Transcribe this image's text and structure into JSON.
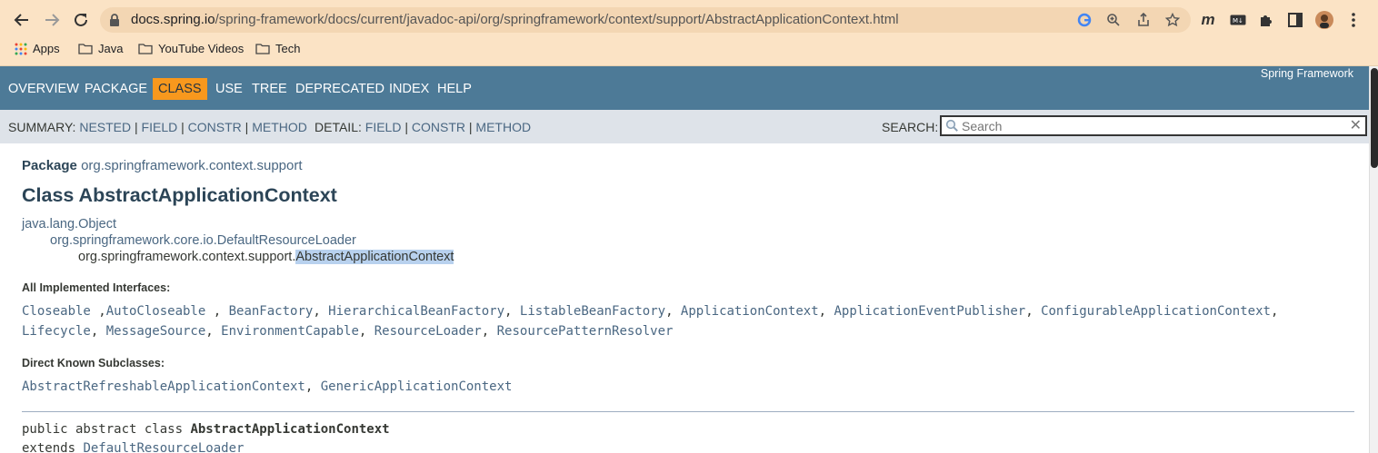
{
  "browser": {
    "url_host": "docs.spring.io",
    "url_path": "/spring-framework/docs/current/javadoc-api/org/springframework/context/support/AbstractApplicationContext.html",
    "bookmarks": [
      "Apps",
      "Java",
      "YouTube Videos",
      "Tech"
    ]
  },
  "topnav": {
    "items": [
      "OVERVIEW",
      "PACKAGE",
      "CLASS",
      "USE",
      "TREE",
      "DEPRECATED",
      "INDEX",
      "HELP"
    ],
    "brand": "Spring Framework"
  },
  "subnav": {
    "summary_label": "SUMMARY:",
    "summary_links": [
      "NESTED",
      "FIELD",
      "CONSTR",
      "METHOD"
    ],
    "detail_label": "DETAIL:",
    "detail_links": [
      "FIELD",
      "CONSTR",
      "METHOD"
    ],
    "search_label": "SEARCH:",
    "search_placeholder": "Search"
  },
  "content": {
    "package_label": "Package",
    "package_name": "org.springframework.context.support",
    "class_title": "Class AbstractApplicationContext",
    "inheritance": [
      "java.lang.Object",
      "org.springframework.core.io.DefaultResourceLoader"
    ],
    "inheritance_leaf_prefix": "org.springframework.context.support.",
    "inheritance_leaf_name": "AbstractApplicationContext",
    "interfaces_label": "All Implemented Interfaces:",
    "interfaces_line1": [
      "Closeable",
      "AutoCloseable",
      "BeanFactory",
      "HierarchicalBeanFactory",
      "ListableBeanFactory",
      "ApplicationContext",
      "ApplicationEventPublisher",
      "ConfigurableApplicationContext"
    ],
    "interfaces_line2": [
      "Lifecycle",
      "MessageSource",
      "EnvironmentCapable",
      "ResourceLoader",
      "ResourcePatternResolver"
    ],
    "subclasses_label": "Direct Known Subclasses:",
    "subclasses": [
      "AbstractRefreshableApplicationContext",
      "GenericApplicationContext"
    ],
    "signature_prefix": "public abstract class ",
    "signature_name": "AbstractApplicationContext",
    "signature_extends": "extends ",
    "signature_super": "DefaultResourceLoader"
  },
  "colors": {
    "nav_bg": "#4d7a97",
    "nav_active": "#f8981d",
    "subnav_bg": "#dee3e9",
    "link": "#4a6782",
    "chrome_bg": "#fbe3c5"
  }
}
